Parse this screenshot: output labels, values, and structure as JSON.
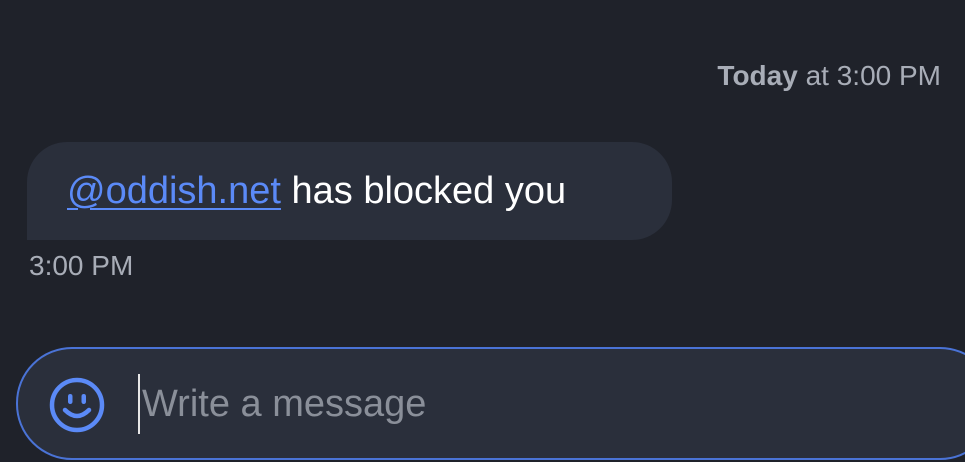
{
  "day_header": {
    "day": "Today",
    "time": "at 3:00 PM"
  },
  "message": {
    "mention": "@oddish.net",
    "text": " has blocked you",
    "time": "3:00 PM"
  },
  "composer": {
    "placeholder": "Write a message",
    "emoji_icon": "smiley-icon"
  },
  "colors": {
    "background": "#1f222a",
    "bubble": "#2a2f3b",
    "accent": "#5b8af7",
    "muted_text": "#a8adb7"
  }
}
